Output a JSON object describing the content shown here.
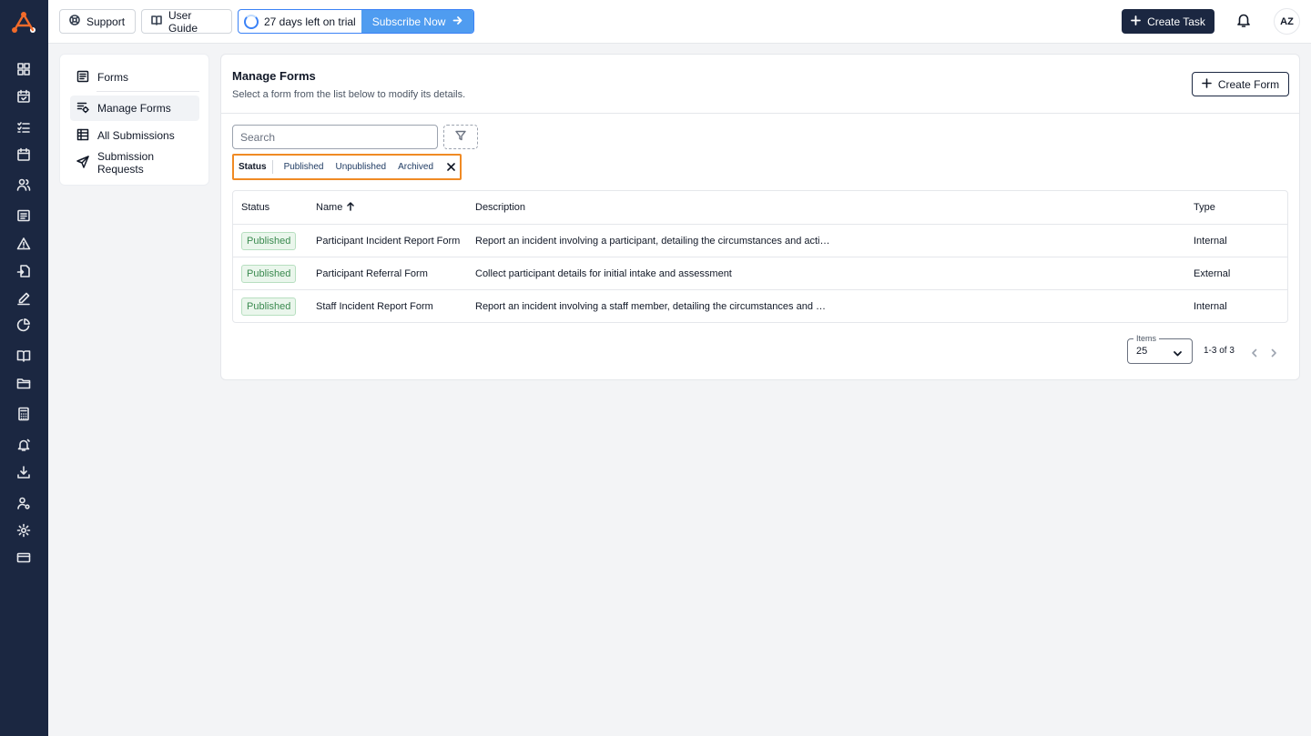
{
  "topbar": {
    "support_label": "Support",
    "user_guide_label": "User Guide",
    "trial_text": "27 days left on trial",
    "subscribe_label": "Subscribe Now",
    "create_task_label": "Create Task",
    "avatar_initials": "AZ"
  },
  "rail": {
    "icons": [
      "dashboard-icon",
      "calendar-check-icon",
      "task-list-icon",
      "calendar-icon",
      "participants-icon",
      "notes-icon",
      "incident-warning-icon",
      "document-import-icon",
      "signature-icon",
      "reports-pie-icon",
      "book-icon",
      "folder-icon",
      "calculator-icon",
      "alarm-bell-icon",
      "download-icon",
      "user-settings-icon",
      "settings-gear-icon",
      "billing-card-icon"
    ]
  },
  "sidemenu": {
    "items": [
      {
        "label": "Forms",
        "icon": "form-icon"
      },
      {
        "label": "Manage Forms",
        "icon": "manage-forms-icon"
      },
      {
        "label": "All Submissions",
        "icon": "table-icon"
      },
      {
        "label": "Submission Requests",
        "icon": "send-icon"
      }
    ]
  },
  "main": {
    "title": "Manage Forms",
    "subtitle": "Select a form from the list below to modify its details.",
    "create_form_label": "Create Form",
    "search_placeholder": "Search",
    "status_filter": {
      "label": "Status",
      "options": [
        "Published",
        "Unpublished",
        "Archived"
      ]
    },
    "table": {
      "columns": [
        "Status",
        "Name",
        "Description",
        "Type"
      ],
      "rows": [
        {
          "status": "Published",
          "name": "Participant Incident Report Form",
          "description": "Report an incident involving a participant, detailing the circumstances and actions taken",
          "type": "Internal"
        },
        {
          "status": "Published",
          "name": "Participant Referral Form",
          "description": "Collect participant details for initial intake and assessment",
          "type": "External"
        },
        {
          "status": "Published",
          "name": "Staff Incident Report Form",
          "description": "Report an incident involving a staff member, detailing the circumstances and actions taken",
          "type": "Internal"
        }
      ]
    },
    "pagination": {
      "items_label": "Items",
      "items_value": "25",
      "range_text": "1-3 of 3"
    }
  },
  "colors": {
    "navy": "#1b2741",
    "accent_blue": "#4f9cf0",
    "highlight_orange": "#f08a24",
    "published_green": "#3a8a4f"
  }
}
